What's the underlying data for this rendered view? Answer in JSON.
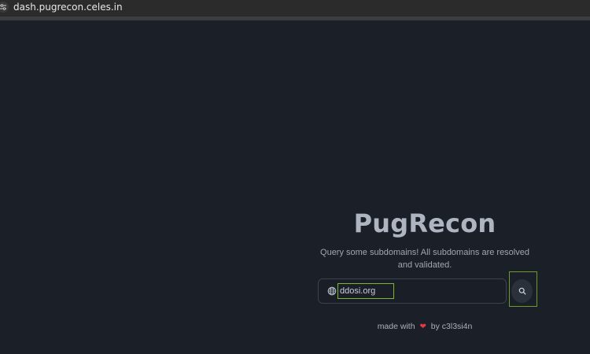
{
  "browser": {
    "url": "dash.pugrecon.celes.in",
    "site_icon": "tune-icon"
  },
  "hero": {
    "title": "PugRecon",
    "subtitle": "Query some subdomains! All subdomains are resolved and validated."
  },
  "search": {
    "value": "ddosi.org",
    "prefix_icon": "globe-icon",
    "button_icon": "search-icon"
  },
  "footer": {
    "made_with": "made with",
    "heart": "❤",
    "by": "by c3l3si4n"
  },
  "colors": {
    "background": "#1b1f27",
    "title": "#aeb5c1",
    "highlight_border": "#7db631",
    "heart": "#e53947"
  }
}
